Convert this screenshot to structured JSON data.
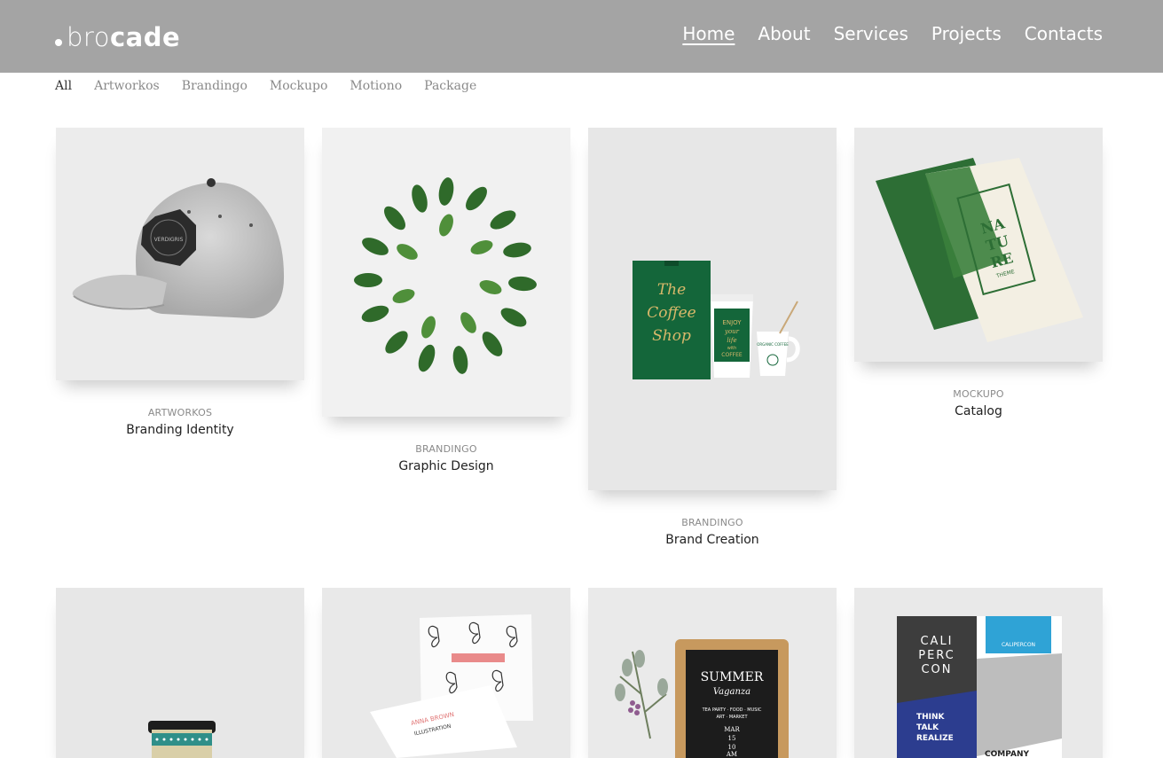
{
  "brand": {
    "prefix": "bro",
    "suffix": "cade"
  },
  "nav": [
    {
      "label": "Home",
      "active": true
    },
    {
      "label": "About"
    },
    {
      "label": "Services"
    },
    {
      "label": "Projects"
    },
    {
      "label": "Contacts"
    }
  ],
  "filters": [
    {
      "label": "All",
      "active": true
    },
    {
      "label": "Artworkos"
    },
    {
      "label": "Brandingo"
    },
    {
      "label": "Mockupo"
    },
    {
      "label": "Motiono"
    },
    {
      "label": "Package"
    }
  ],
  "portfolio": [
    {
      "category": "ARTWORKOS",
      "title": "Branding Identity",
      "image_text": [
        "VERDIGRIS"
      ]
    },
    {
      "category": "BRANDINGO",
      "title": "Graphic Design"
    },
    {
      "category": "BRANDINGO",
      "title": "Brand Creation",
      "image_text": [
        "The",
        "Coffee",
        "Shop",
        "ENJOY",
        "your",
        "life",
        "with",
        "COFFEE",
        "ORGANIC COFFEE"
      ]
    },
    {
      "category": "MOCKUPO",
      "title": "Catalog",
      "image_text": [
        "NA",
        "TU",
        "RE",
        "THEME"
      ]
    },
    {
      "image_text": []
    },
    {
      "image_text": [
        "ANNA BROWN",
        "ILLUSTRATION"
      ]
    },
    {
      "image_text": [
        "SUMMER",
        "Vaganza",
        "TEA PARTY · FOOD · MUSIC",
        "ART · MARKET",
        "MAR",
        "15",
        "10",
        "AM"
      ]
    },
    {
      "image_text": [
        "CALI",
        "PERC",
        "CON",
        "CALIPERCON",
        "THINK",
        "TALK",
        "REALIZE",
        "COMPANY"
      ]
    }
  ],
  "colors": {
    "header_bg": "#a4a4a4",
    "card_bg": "#e8e8e8",
    "green": "#1f6b3a"
  }
}
